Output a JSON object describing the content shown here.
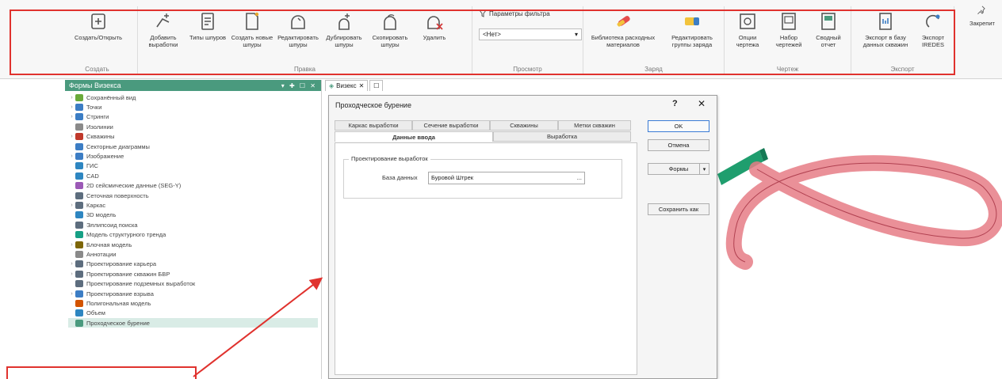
{
  "ribbon": {
    "groups": [
      {
        "label": "Создать",
        "buttons": [
          {
            "label": "Создать/Открыть",
            "icon": "create-open-icon"
          }
        ]
      },
      {
        "label": "Правка",
        "buttons": [
          {
            "label": "Добавить выработки",
            "icon": "add-workings-icon"
          },
          {
            "label": "Типы шпуров",
            "icon": "hole-types-icon"
          },
          {
            "label": "Создать новые шпуры",
            "icon": "create-holes-icon"
          },
          {
            "label": "Редактировать шпуры",
            "icon": "edit-holes-icon"
          },
          {
            "label": "Дублировать шпуры",
            "icon": "duplicate-holes-icon"
          },
          {
            "label": "Скопировать шпуры",
            "icon": "copy-holes-icon"
          },
          {
            "label": "Удалить",
            "icon": "delete-icon"
          }
        ]
      },
      {
        "label": "Просмотр",
        "filter_title": "Параметры фильтра",
        "filter_value": "<Нет>"
      },
      {
        "label": "Заряд",
        "buttons": [
          {
            "label": "Библиотека расходных материалов",
            "icon": "consumables-library-icon"
          },
          {
            "label": "Редактировать группы заряда",
            "icon": "edit-charge-groups-icon"
          }
        ]
      },
      {
        "label": "Чертеж",
        "buttons": [
          {
            "label": "Опции чертежа",
            "icon": "drawing-options-icon"
          },
          {
            "label": "Набор чертежей",
            "icon": "drawing-set-icon"
          },
          {
            "label": "Сводный отчет",
            "icon": "summary-report-icon"
          }
        ]
      },
      {
        "label": "Экспорт",
        "buttons": [
          {
            "label": "Экспорт в базу данных скважин",
            "icon": "export-db-icon"
          },
          {
            "label": "Экспорт IREDES",
            "icon": "export-iredes-icon"
          }
        ]
      }
    ],
    "pin_label": "Закрепит"
  },
  "left_panel": {
    "title": "Формы Визекса",
    "controls": "▾ ✚ ☐ ✕",
    "items": [
      {
        "label": "Сохранённый вид",
        "expand": "›",
        "color": "#6aaa3a"
      },
      {
        "label": "Точки",
        "expand": "›",
        "color": "#3c7dc4"
      },
      {
        "label": "Стринги",
        "expand": "›",
        "color": "#3c7dc4"
      },
      {
        "label": "Изолинии",
        "expand": "",
        "color": "#8a8a8a"
      },
      {
        "label": "Скважины",
        "expand": "›",
        "color": "#c0392b"
      },
      {
        "label": "Секторные диаграммы",
        "expand": "",
        "color": "#3c7dc4"
      },
      {
        "label": "Изображение",
        "expand": "›",
        "color": "#3c7dc4"
      },
      {
        "label": "ГИС",
        "expand": "",
        "color": "#2e86c1"
      },
      {
        "label": "CAD",
        "expand": "",
        "color": "#2e86c1"
      },
      {
        "label": "2D сейсмические данные (SEG-Y)",
        "expand": "",
        "color": "#9b59b6"
      },
      {
        "label": "Сеточная поверхность",
        "expand": "",
        "color": "#5d6d7e"
      },
      {
        "label": "Каркас",
        "expand": "›",
        "color": "#5d6d7e"
      },
      {
        "label": "3D модель",
        "expand": "",
        "color": "#2e86c1"
      },
      {
        "label": "Эллипсоид поиска",
        "expand": "",
        "color": "#5d6d7e"
      },
      {
        "label": "Модель структурного тренда",
        "expand": "",
        "color": "#16a085"
      },
      {
        "label": "Блочная модель",
        "expand": "›",
        "color": "#7d6608"
      },
      {
        "label": "Аннотации",
        "expand": "",
        "color": "#8a8a8a"
      },
      {
        "label": "Проектирование карьера",
        "expand": "›",
        "color": "#5d6d7e"
      },
      {
        "label": "Проектирование скважин БВР",
        "expand": "›",
        "color": "#5d6d7e"
      },
      {
        "label": "Проектирование подземных выработок",
        "expand": "",
        "color": "#5d6d7e"
      },
      {
        "label": "Проектирование взрыва",
        "expand": "›",
        "color": "#3c7dc4"
      },
      {
        "label": "Полигональная модель",
        "expand": "",
        "color": "#d35400"
      },
      {
        "label": "Объем",
        "expand": "",
        "color": "#2e86c1"
      },
      {
        "label": "Проходческое бурение",
        "expand": "",
        "color": "#4a9a7e",
        "selected": true
      }
    ]
  },
  "doc_tabs": [
    {
      "label": "Визекс"
    }
  ],
  "dialog": {
    "title": "Проходческое бурение",
    "help": "?",
    "close": "✕",
    "tabs_row1": [
      "Каркас выработки",
      "Сечение выработки",
      "Скважины",
      "Метки скважин"
    ],
    "tabs_row2": [
      "Данные ввода",
      "Выработка"
    ],
    "active_tab": "Данные ввода",
    "group_title": "Проектирование выработок",
    "field_label": "База данных",
    "field_value": "Буровой Штрек",
    "field_button": "...",
    "buttons": {
      "ok": "OK",
      "cancel": "Отмена",
      "forms": "Формы",
      "save_as": "Сохранить как"
    }
  },
  "colors": {
    "accent": "#4a9a7e",
    "highlight": "#e0322e",
    "solid_green": "#1f9e6e",
    "tunnel_red": "#e67c86"
  }
}
